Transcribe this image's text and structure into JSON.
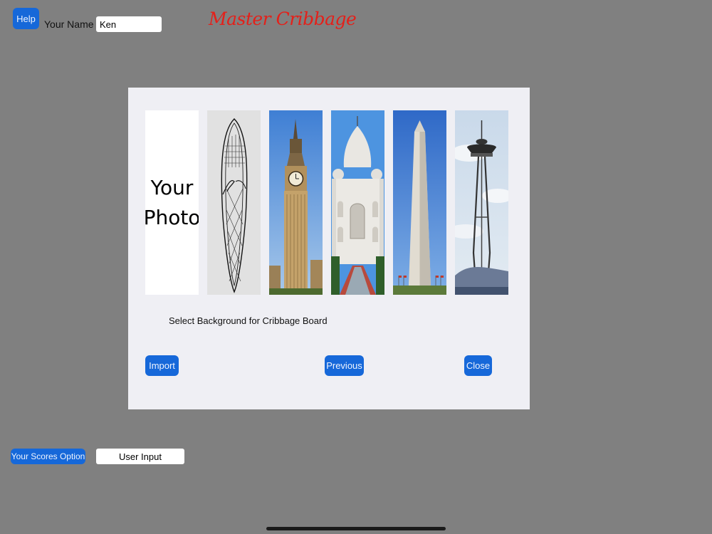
{
  "header": {
    "help_label": "Help",
    "name_label": "Your Name",
    "name_value": "Ken",
    "app_title": "Master Cribbage"
  },
  "dialog": {
    "your_photo_line1": "Your",
    "your_photo_line2": "Photo",
    "caption": "Select Background for Cribbage Board",
    "import_label": "Import",
    "previous_label": "Previous",
    "close_label": "Close"
  },
  "footer": {
    "scores_label": "Your Scores Option",
    "scores_value": "User Input"
  },
  "colors": {
    "background": "#808080",
    "button_blue": "#1668d9",
    "title_red": "#e4201a",
    "dialog_bg": "#efeff4"
  },
  "icons": [
    "snowshoe-image",
    "big-ben-image",
    "taj-mahal-image",
    "washington-monument-image",
    "space-needle-image"
  ]
}
